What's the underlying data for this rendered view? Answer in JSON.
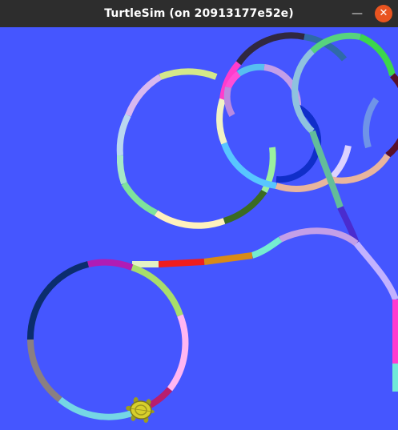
{
  "window": {
    "title": "TurtleSim (on 20913177e52e)",
    "minimize_glyph": "—",
    "close_glyph": "✕"
  },
  "canvas": {
    "background_color": "#4556ff"
  },
  "icons": {
    "minimize": "minimize-icon",
    "close": "close-icon",
    "turtle": "turtle-icon"
  }
}
